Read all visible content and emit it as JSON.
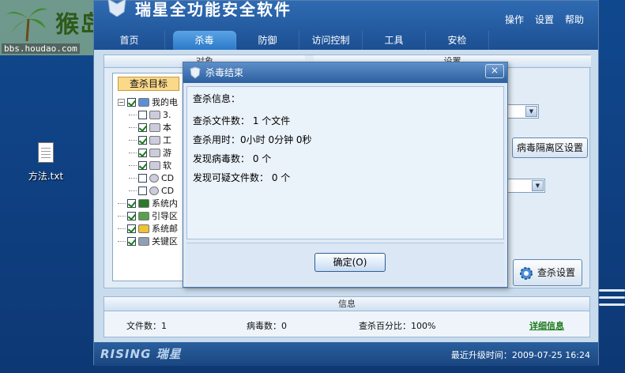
{
  "watermark": {
    "text": "猴岛",
    "url": "bbs.houdao.com"
  },
  "desktop": {
    "file_label": "方法.txt"
  },
  "app": {
    "title": "瑞星全功能安全软件",
    "menu": [
      "操作",
      "设置",
      "帮助"
    ],
    "tabs": [
      "首页",
      "杀毒",
      "防御",
      "访问控制",
      "工具",
      "安检"
    ],
    "panes": {
      "left_header": "对象",
      "right_header": "设置"
    },
    "scan_target_label": "查杀目标",
    "tree": [
      {
        "label": "我的电",
        "checked": true,
        "icon": "computer-icon"
      },
      {
        "label": "3.",
        "checked": false,
        "icon": "drive-icon"
      },
      {
        "label": "本",
        "checked": true,
        "icon": "drive-icon"
      },
      {
        "label": "工",
        "checked": true,
        "icon": "drive-icon"
      },
      {
        "label": "游",
        "checked": true,
        "icon": "drive-icon"
      },
      {
        "label": "软",
        "checked": true,
        "icon": "drive-icon"
      },
      {
        "label": "CD",
        "checked": false,
        "icon": "cd-icon"
      },
      {
        "label": "CD",
        "checked": false,
        "icon": "cd-icon"
      },
      {
        "label": "系统内",
        "checked": true,
        "icon": "memory-icon"
      },
      {
        "label": "引导区",
        "checked": true,
        "icon": "boot-icon"
      },
      {
        "label": "系统邮",
        "checked": true,
        "icon": "mail-icon"
      },
      {
        "label": "关键区",
        "checked": true,
        "icon": "key-area-icon"
      }
    ],
    "quarantine_button": "病毒隔离区设置",
    "scan_settings_button": "查杀设置",
    "info": {
      "header": "信息",
      "files": "文件数：1",
      "viruses": "病毒数：0",
      "percent": "查杀百分比：100%",
      "detail_link": "详细信息"
    },
    "footer": {
      "brand": "RISING 瑞星",
      "update": "最近升级时间：2009-07-25 16:24"
    }
  },
  "dialog": {
    "title": "杀毒结束",
    "heading": "查杀信息：",
    "lines": [
      "查杀文件数： 1 个文件",
      "查杀用时：0小时 0分钟 0秒",
      "发现病毒数：  0 个",
      "发现可疑文件数：  0 个"
    ],
    "ok_button": "确定(O)",
    "close_glyph": "×"
  }
}
